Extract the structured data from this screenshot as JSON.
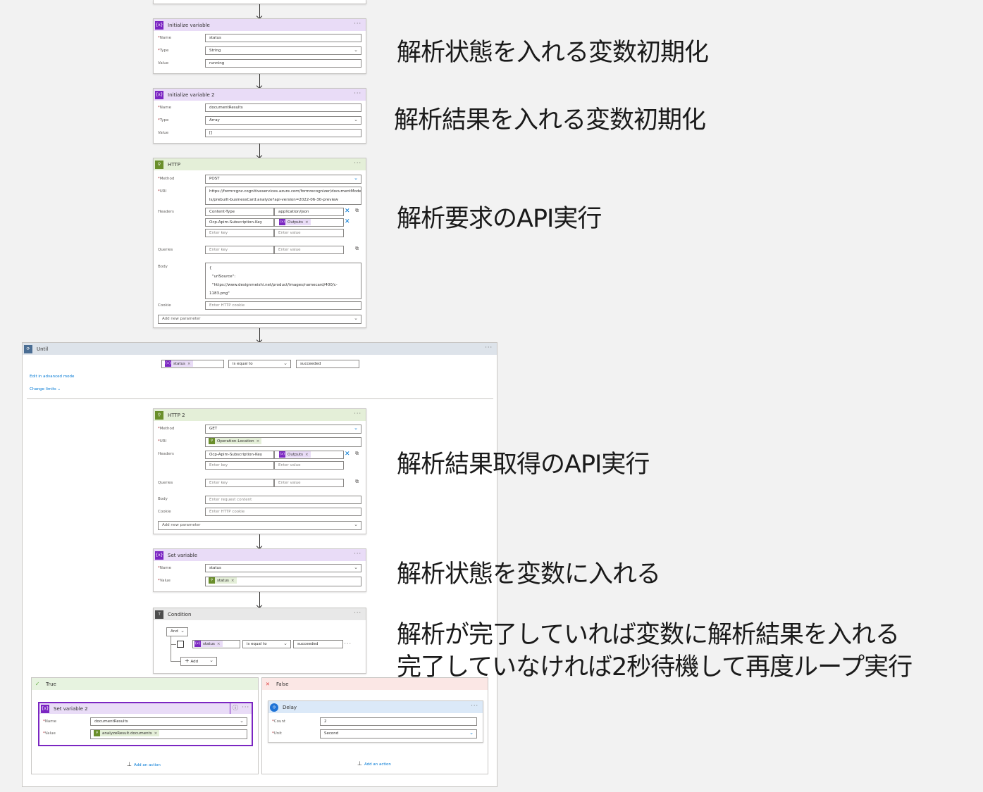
{
  "init1": {
    "title": "Initialize variable",
    "name_label": "Name",
    "name_value": "status",
    "type_label": "Type",
    "type_value": "String",
    "value_label": "Value",
    "value_value": "running"
  },
  "init2": {
    "title": "Initialize variable 2",
    "name_label": "Name",
    "name_value": "documentResults",
    "type_label": "Type",
    "type_value": "Array",
    "value_label": "Value",
    "value_value": "[]"
  },
  "http1": {
    "title": "HTTP",
    "method_label": "Method",
    "method_value": "POST",
    "uri_label": "URI",
    "uri_line1": "https://formrcgnz.cognitiveservices.azure.com/formrecognizer/documentMode",
    "uri_line2": "ls/prebuilt-businessCard:analyze?api-version=2022-06-30-preview",
    "headers_label": "Headers",
    "header1_key": "Content-Type",
    "header1_value": "application/json",
    "header2_key": "Ocp-Apim-Subscription-Key",
    "header2_token": "Outputs",
    "key_placeholder": "Enter key",
    "value_placeholder": "Enter value",
    "queries_label": "Queries",
    "body_label": "Body",
    "body_line1": "{",
    "body_line2": "\"urlSource\": \"https://www.designmeishi.net/product/images/namecard/400/c-",
    "body_line3": "1183.png\"",
    "body_line4": "}",
    "cookie_label": "Cookie",
    "cookie_placeholder": "Enter HTTP cookie",
    "add_param": "Add new parameter"
  },
  "until": {
    "title": "Until",
    "cond_token": "status",
    "cond_op": "is equal to",
    "cond_value": "succeeded",
    "edit_advanced": "Edit in advanced mode",
    "change_limits": "Change limits"
  },
  "http2": {
    "title": "HTTP 2",
    "method_label": "Method",
    "method_value": "GET",
    "uri_label": "URI",
    "uri_token": "Operation-Location",
    "headers_label": "Headers",
    "header1_key": "Ocp-Apim-Subscription-Key",
    "header1_token": "Outputs",
    "key_placeholder": "Enter key",
    "value_placeholder": "Enter value",
    "queries_label": "Queries",
    "body_label": "Body",
    "body_placeholder": "Enter request content",
    "cookie_label": "Cookie",
    "cookie_placeholder": "Enter HTTP cookie",
    "add_param": "Add new parameter"
  },
  "setvar": {
    "title": "Set variable",
    "name_label": "Name",
    "name_value": "status",
    "value_label": "Value",
    "value_token": "status"
  },
  "condition": {
    "title": "Condition",
    "and_label": "And",
    "token": "status",
    "op": "is equal to",
    "value": "succeeded",
    "add_label": "Add"
  },
  "true_branch": {
    "title": "True",
    "setvar2_title": "Set variable 2",
    "name_label": "Name",
    "name_value": "documentResults",
    "value_label": "Value",
    "value_token": "analyzeResult.documents",
    "add_action": "Add an action"
  },
  "false_branch": {
    "title": "False",
    "delay_title": "Delay",
    "count_label": "Count",
    "count_value": "2",
    "unit_label": "Unit",
    "unit_value": "Second",
    "add_action": "Add an action"
  },
  "annotations": {
    "a1": "解析状態を入れる変数初期化",
    "a2": "解析結果を入れる変数初期化",
    "a3": "解析要求のAPI実行",
    "a4": "解析結果取得のAPI実行",
    "a5": "解析状態を変数に入れる",
    "a6_line1": "解析が完了していれば変数に解析結果を入れる",
    "a6_line2": "完了していなければ2秒待機して再度ループ実行"
  }
}
